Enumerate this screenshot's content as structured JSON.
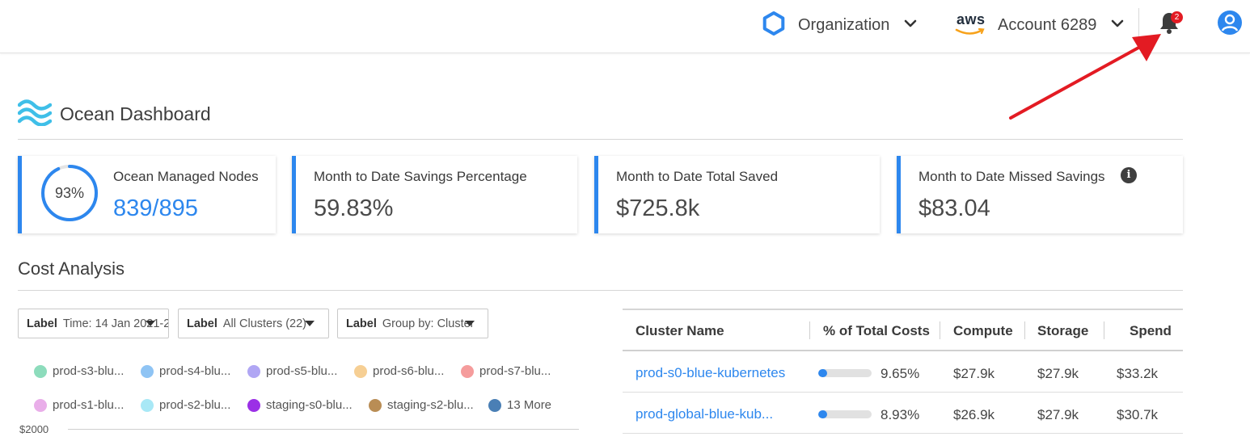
{
  "topbar": {
    "org_label": "Organization",
    "account_label": "Account 6289",
    "aws_logo_text": "aws",
    "notification_count": "2"
  },
  "page": {
    "title": "Ocean Dashboard"
  },
  "stats": {
    "managed_nodes": {
      "title": "Ocean Managed Nodes",
      "value": "839/895",
      "ring_percent_label": "93%",
      "ring_fraction": 0.93
    },
    "savings_pct": {
      "title": "Month to Date Savings Percentage",
      "value": "59.83%"
    },
    "total_saved": {
      "title": "Month to Date Total Saved",
      "value": "$725.8k"
    },
    "missed_savings": {
      "title": "Month to Date Missed Savings",
      "value": "$83.04"
    }
  },
  "cost_analysis": {
    "title": "Cost Analysis",
    "filters": [
      {
        "label": "Label",
        "value": "Time: 14 Jan 2021-2"
      },
      {
        "label": "Label",
        "value": "All Clusters (22)"
      },
      {
        "label": "Label",
        "value": "Group by: Cluster"
      }
    ],
    "legend": [
      {
        "name": "prod-s3-blu...",
        "color": "#8ddcbc"
      },
      {
        "name": "prod-s4-blu...",
        "color": "#8fc4f4"
      },
      {
        "name": "prod-s5-blu...",
        "color": "#b0a6f4"
      },
      {
        "name": "prod-s6-blu...",
        "color": "#f6cf94"
      },
      {
        "name": "prod-s7-blu...",
        "color": "#f59c9c"
      },
      {
        "name": "prod-s1-blu...",
        "color": "#e9aee9"
      },
      {
        "name": "prod-s2-blu...",
        "color": "#a8e8f6"
      },
      {
        "name": "staging-s0-blu...",
        "color": "#9b30e6"
      },
      {
        "name": "staging-s2-blu...",
        "color": "#b98d55"
      },
      {
        "name": "13 More",
        "color": "#4a7fb5"
      }
    ],
    "y_axis_top_label": "$2000"
  },
  "table": {
    "headers": [
      "Cluster Name",
      "% of Total Costs",
      "Compute",
      "Storage",
      "Spend"
    ],
    "rows": [
      {
        "name": "prod-s0-blue-kubernetes",
        "pct": "9.65%",
        "pct_fraction": 0.17,
        "compute": "$27.9k",
        "storage": "$27.9k",
        "spend": "$33.2k"
      },
      {
        "name": "prod-global-blue-kub...",
        "pct": "8.93%",
        "pct_fraction": 0.16,
        "compute": "$26.9k",
        "storage": "$27.9k",
        "spend": "$30.7k"
      }
    ]
  },
  "colors": {
    "accent": "#2d87ee",
    "annotation_arrow": "#e31b23",
    "badge": "#e31b23"
  },
  "icons": [
    "org-hexagon-icon",
    "aws-logo-icon",
    "chevron-down-icon",
    "bell-icon",
    "user-avatar-icon",
    "ocean-waves-icon",
    "info-icon",
    "caret-down-icon"
  ]
}
